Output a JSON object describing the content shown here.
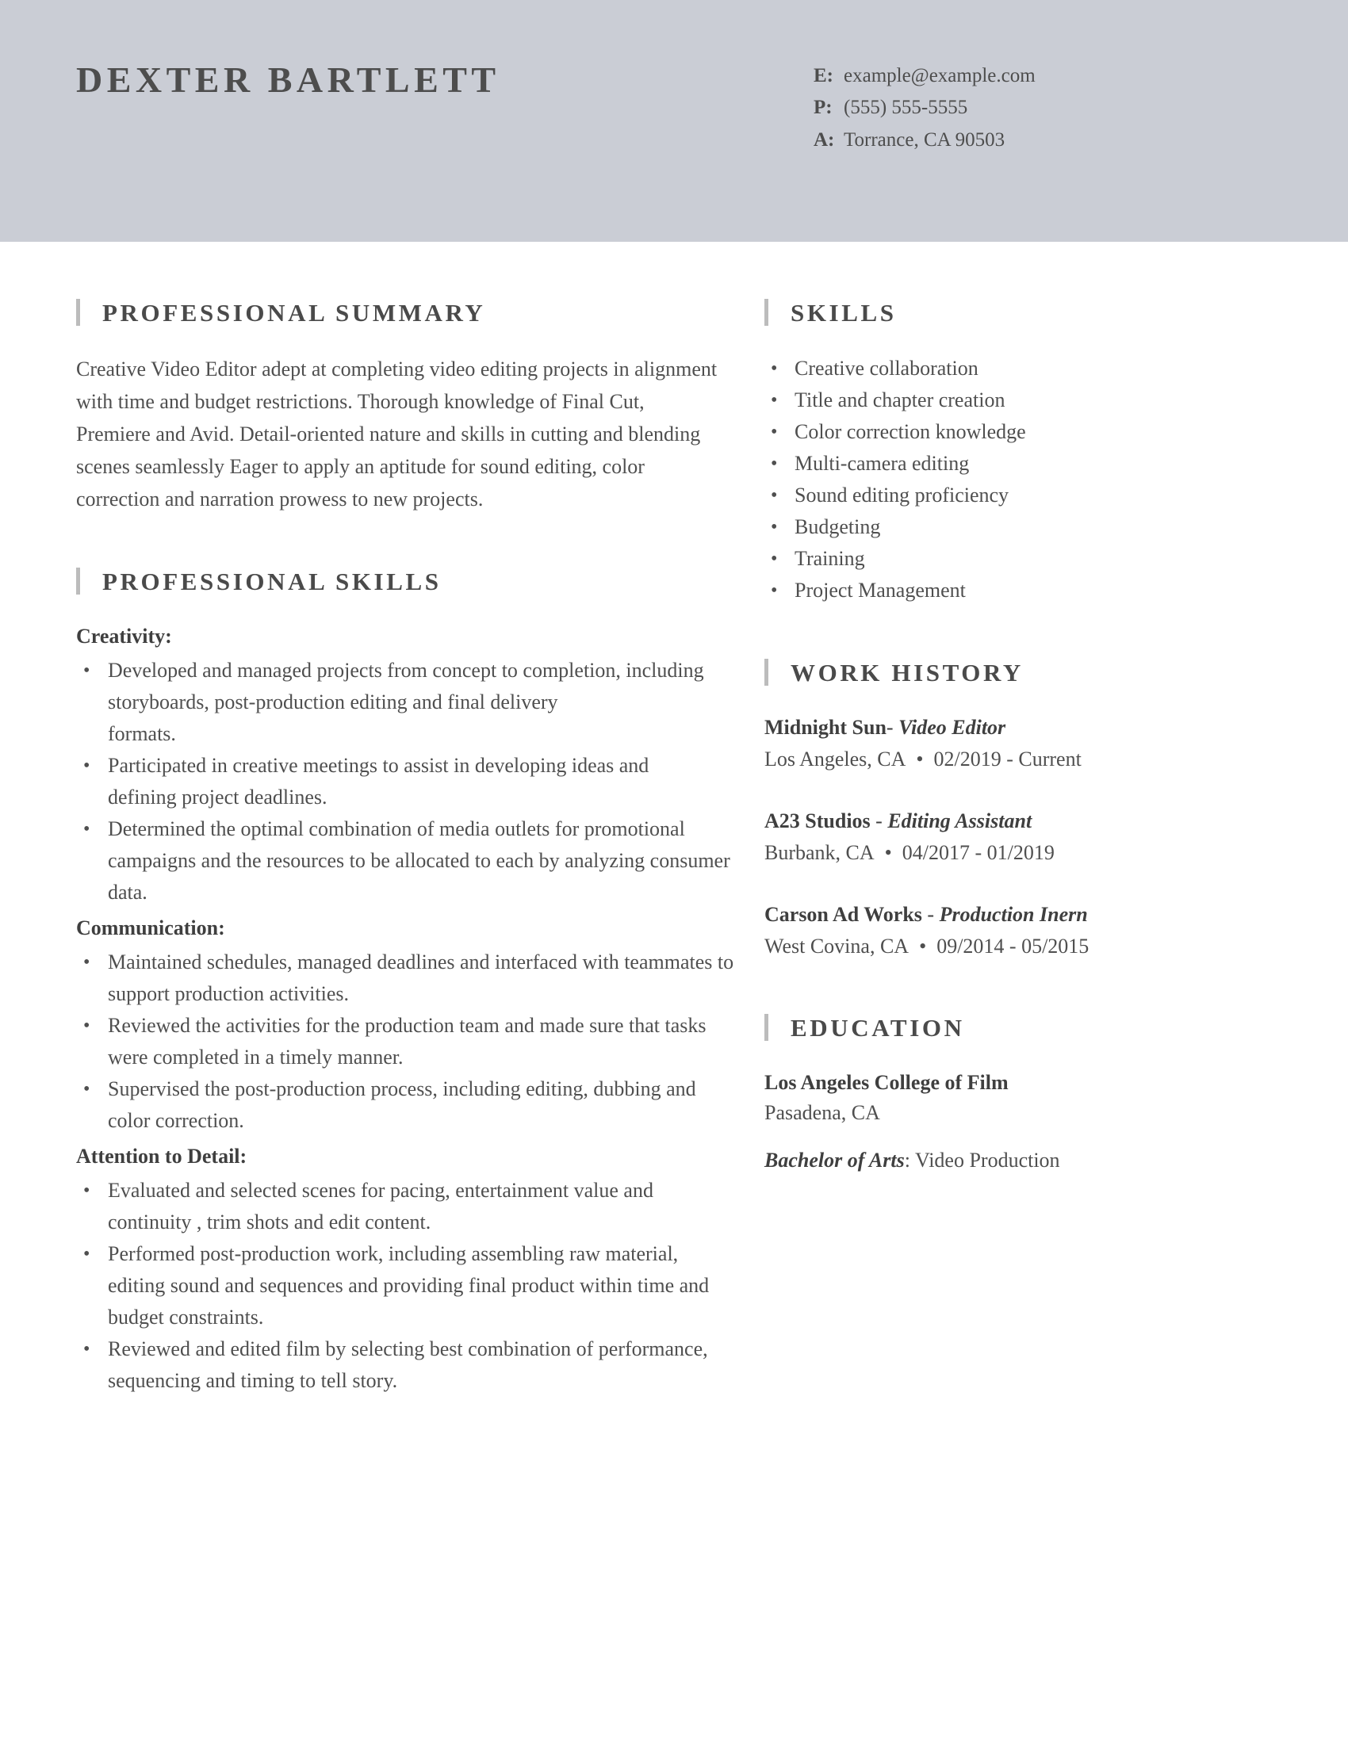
{
  "header": {
    "full_name": "DEXTER BARTLETT",
    "contacts": [
      {
        "key": "E:",
        "value": "example@example.com"
      },
      {
        "key": "P:",
        "value": "(555) 555-5555"
      },
      {
        "key": "A:",
        "value": "Torrance, CA 90503"
      }
    ]
  },
  "left_column": {
    "professional_summary": {
      "heading": "PROFESSIONAL SUMMARY",
      "text": "Creative Video Editor adept at completing video editing projects in alignment with time and budget restrictions. Thorough knowledge of Final Cut, Premiere and Avid. Detail-oriented nature and skills in cutting and blending scenes seamlessly Eager to apply an aptitude for sound editing, color correction and narration prowess to new projects."
    },
    "professional_skills": {
      "heading": "PROFESSIONAL SKILLS",
      "groups": [
        {
          "label": "Creativity:",
          "items": [
            "Developed and managed projects from concept to completion, including storyboards, post-production editing and final delivery\nformats.",
            "Participated in creative meetings to assist in developing ideas and\ndefining project deadlines.",
            "Determined the optimal combination of media outlets for promotional campaigns and the resources to be allocated to each by analyzing consumer data."
          ]
        },
        {
          "label": "Communication:",
          "items": [
            "Maintained schedules, managed deadlines and interfaced with teammates to support production activities.",
            "Reviewed the activities for the production team and made sure that tasks were completed in a timely manner.",
            "Supervised the post-production process, including editing, dubbing and color correction."
          ]
        },
        {
          "label": "Attention to Detail:",
          "items": [
            "Evaluated and selected scenes for pacing, entertainment value and continuity , trim shots and edit content.",
            "Performed post-production work, including assembling raw material, editing sound and sequences and providing final product within time and budget constraints.",
            "Reviewed and edited film by selecting best combination of performance, sequencing and timing to tell story."
          ]
        }
      ]
    }
  },
  "right_column": {
    "skills": {
      "heading": "SKILLS",
      "items": [
        "Creative collaboration",
        "Title and chapter creation",
        "Color correction knowledge",
        "Multi-camera editing",
        "Sound editing proficiency",
        "Budgeting",
        "Training",
        "Project Management"
      ]
    },
    "work_history": {
      "heading": "WORK HISTORY",
      "jobs": [
        {
          "company": " Midnight Sun",
          "separator": "-",
          "role": " Video Editor",
          "location": "Los Angeles, CA",
          "bullet": "•",
          "dates": "02/2019 - Current"
        },
        {
          "company": "A23 Studios",
          "separator": " - ",
          "role": "Editing Assistant",
          "location": "Burbank, CA",
          "bullet": "•",
          "dates": "04/2017 - 01/2019"
        },
        {
          "company": "Carson Ad Works",
          "separator": " - ",
          "role": "Production Inern",
          "location": "West Covina, CA",
          "bullet": "•",
          "dates": "09/2014 - 05/2015"
        }
      ]
    },
    "education": {
      "heading": "EDUCATION",
      "school": "Los Angeles College of Film",
      "location": "Pasadena, CA",
      "degree": "Bachelor of Arts",
      "degree_field": ": Video Production"
    }
  },
  "theme": {
    "header_background": "#cacdd5",
    "text_color": "#4f4f4f",
    "heading_color": "#4a4a4a",
    "accent_bar": "#bcbcbc",
    "page_background": "#ffffff"
  }
}
